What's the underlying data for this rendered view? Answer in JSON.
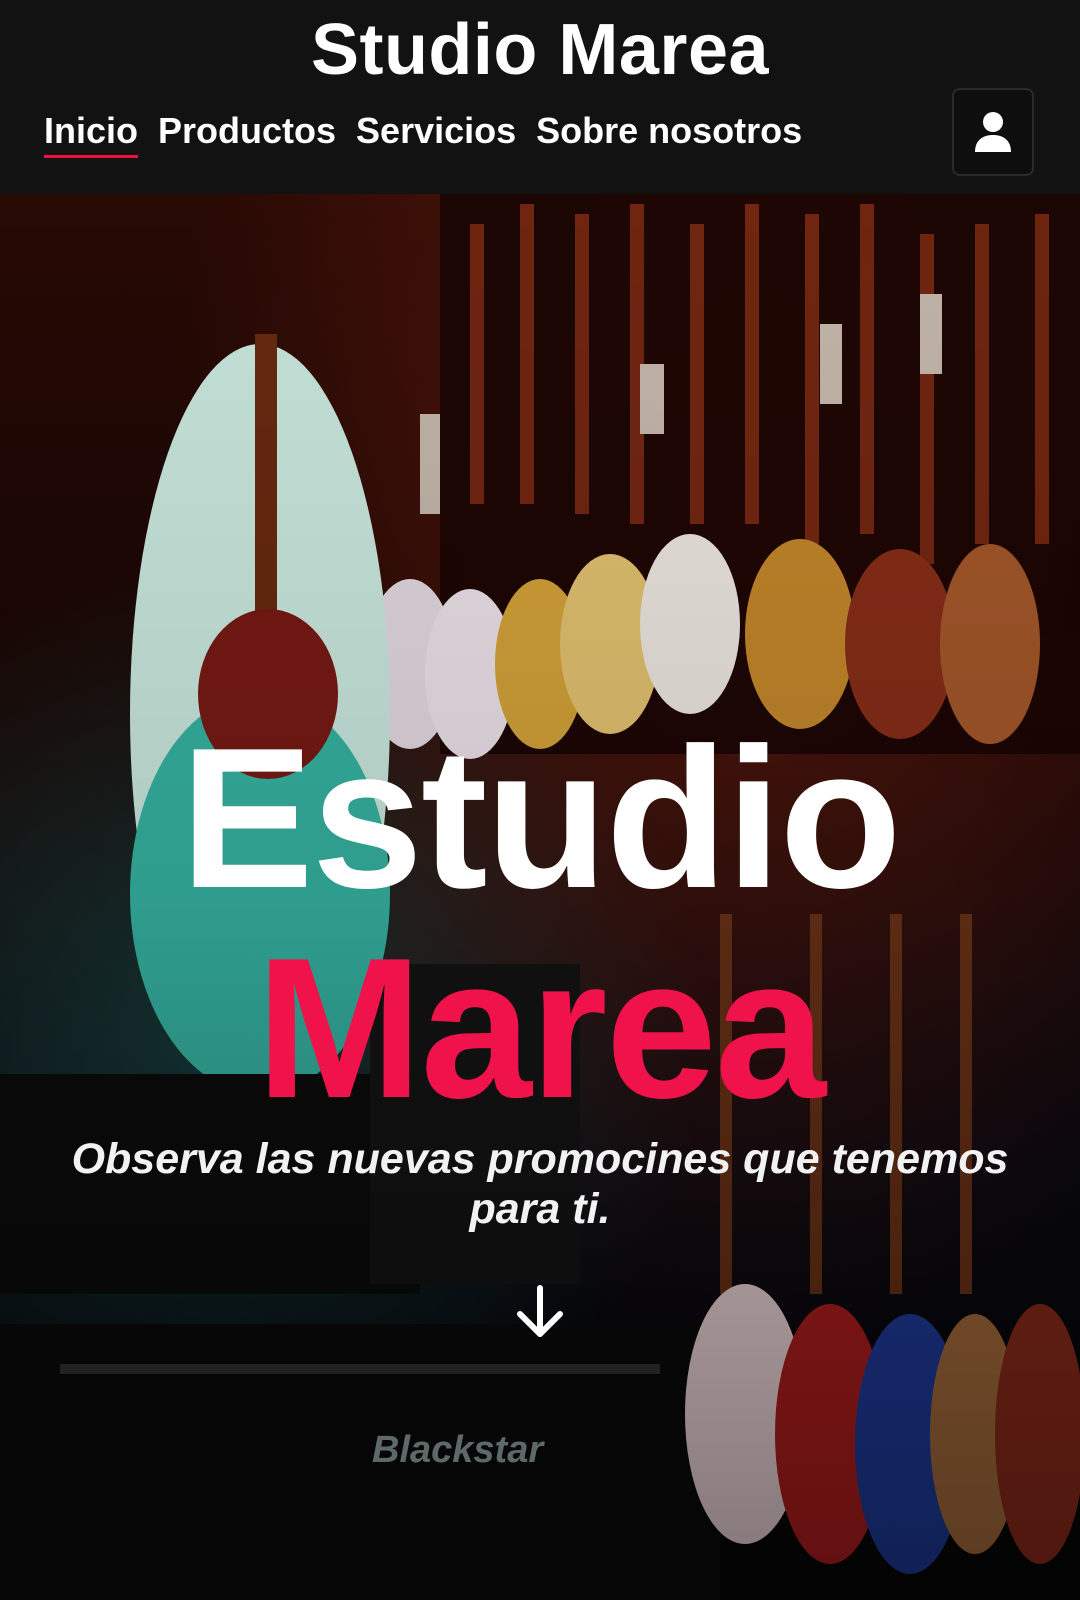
{
  "header": {
    "brand": "Studio Marea",
    "nav": [
      {
        "label": "Inicio",
        "active": true
      },
      {
        "label": "Productos",
        "active": false
      },
      {
        "label": "Servicios",
        "active": false
      },
      {
        "label": "Sobre nosotros",
        "active": false
      }
    ],
    "user_icon": "user-icon"
  },
  "hero": {
    "title_line1": "Estudio",
    "title_line2": "Marea",
    "subtitle": "Observa las nuevas promocines que tenemos para ti.",
    "scroll_icon": "arrow-down-icon",
    "background_image": "guitar-store-wall"
  },
  "colors": {
    "header_bg": "#121212",
    "accent": "#f0124a",
    "text": "#ffffff"
  }
}
